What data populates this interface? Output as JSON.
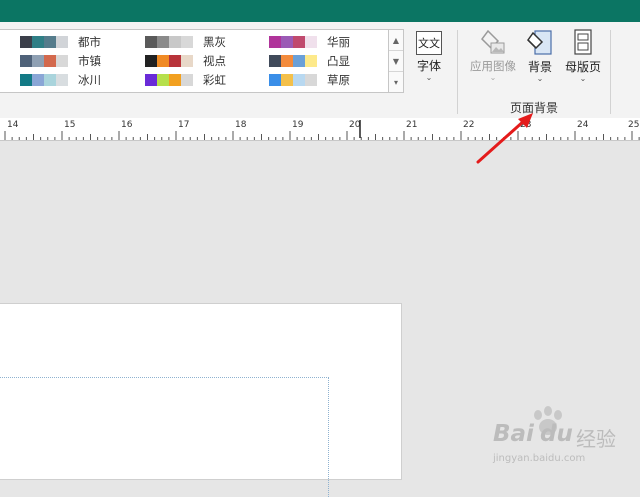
{
  "colors": {
    "titlebar": "#0b7563",
    "ribbon": "#f3f3f3",
    "arrow": "#e41b1b"
  },
  "themes": [
    {
      "name": "都市",
      "colors": [
        "#3b3f4a",
        "#2f7f86",
        "#557c8c",
        "#d1d4d8"
      ]
    },
    {
      "name": "黑灰",
      "colors": [
        "#5a5a5a",
        "#8a8a8a",
        "#c8c8c8",
        "#d8d8d8"
      ]
    },
    {
      "name": "华丽",
      "colors": [
        "#b0339a",
        "#9b5bb5",
        "#c04a6e",
        "#f0e0ec"
      ]
    },
    {
      "name": "市镇",
      "colors": [
        "#4f6279",
        "#8fa0b3",
        "#d3694d",
        "#d8d8d8"
      ]
    },
    {
      "name": "视点",
      "colors": [
        "#222222",
        "#f08a24",
        "#b8333a",
        "#e8d8c8"
      ]
    },
    {
      "name": "凸显",
      "colors": [
        "#404a5a",
        "#f38b3c",
        "#6aa0d8",
        "#fde98a"
      ]
    },
    {
      "name": "冰川",
      "colors": [
        "#137a86",
        "#8aa6d6",
        "#a9d4dc",
        "#d8dde0"
      ]
    },
    {
      "name": "彩虹",
      "colors": [
        "#6a2bd8",
        "#b6e04c",
        "#f2a020",
        "#d8d8d8"
      ]
    },
    {
      "name": "草原",
      "colors": [
        "#3a8ee8",
        "#f4c04a",
        "#b8d8f0",
        "#d8d8d8"
      ]
    }
  ],
  "ribbon": {
    "font_icon": "文文",
    "font_label": "字体",
    "apply_image_label": "应用图像",
    "background_label": "背景",
    "master_label": "母版页",
    "group_label": "页面背景",
    "dropdown_glyph": "⌄"
  },
  "ruler": {
    "labels": [
      "14",
      "15",
      "16",
      "17",
      "18",
      "19",
      "20",
      "21",
      "22",
      "23",
      "24",
      "25"
    ]
  },
  "watermark": {
    "brand": "Bai",
    "brand2": "du",
    "suffix": "经验",
    "url": "jingyan.baidu.com"
  }
}
